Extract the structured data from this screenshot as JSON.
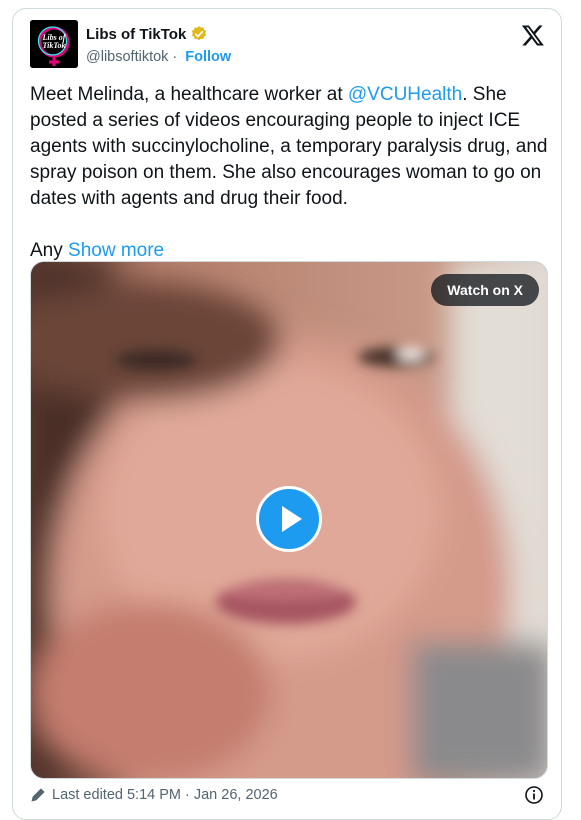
{
  "author": {
    "display_name": "Libs of TikTok",
    "handle": "@libsoftiktok",
    "separator": "·",
    "follow_label": "Follow",
    "avatar_text_line1": "Libs of",
    "avatar_text_line2": "TikTok",
    "verified_icon": "gold-verified-badge",
    "verified_color": "#e2b719"
  },
  "tweet": {
    "text_before_mention": "Meet Melinda, a healthcare worker at ",
    "mention": "@VCUHealth",
    "text_after_mention": ". She posted a series of videos encouraging people to inject ICE agents with succinylocholine, a temporary paralysis drug, and spray poison on them. She also encourages woman to go on dates with agents and drug their food.",
    "more_prefix": "Any",
    "show_more_label": "Show more"
  },
  "media": {
    "watch_label": "Watch on X",
    "play_icon": "play-icon"
  },
  "footer": {
    "edited_text": "Last edited 5:14 PM · Jan 26, 2026",
    "edit_icon": "pencil-icon",
    "info_icon": "info-icon"
  },
  "colors": {
    "accent": "#1d9bf0",
    "text": "#0f1419",
    "muted": "#536471",
    "border": "#cfd9de"
  }
}
